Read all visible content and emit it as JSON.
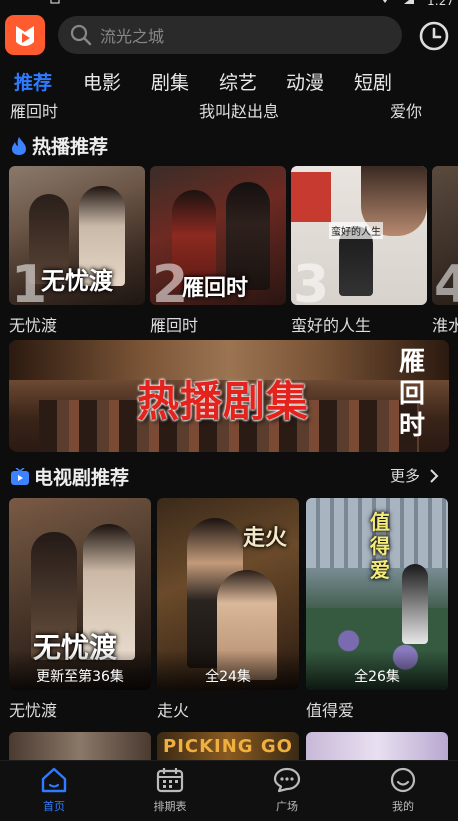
{
  "status_bar": {
    "time": "1:27"
  },
  "header": {
    "logo_icon": "app-logo-icon",
    "search_placeholder": "流光之城",
    "history_icon": "clock-icon"
  },
  "tabs": [
    {
      "label": "推荐",
      "active": true
    },
    {
      "label": "电影"
    },
    {
      "label": "剧集"
    },
    {
      "label": "综艺"
    },
    {
      "label": "动漫"
    },
    {
      "label": "短剧"
    }
  ],
  "marquee": [
    "雁回时",
    "我叫赵出息",
    "爱你"
  ],
  "hot": {
    "title": "热播推荐",
    "items": [
      {
        "rank": "1",
        "title": "无忧渡",
        "poster_text": "无忧渡"
      },
      {
        "rank": "2",
        "title": "雁回时",
        "poster_text": "雁回时"
      },
      {
        "rank": "3",
        "title": "蛮好的人生",
        "poster_text": "蛮好的人生"
      },
      {
        "rank": "4",
        "title": "淮水"
      }
    ]
  },
  "banner": {
    "text": "热播剧集",
    "vertical_text": "雁回时"
  },
  "tv": {
    "title": "电视剧推荐",
    "more_label": "更多",
    "items": [
      {
        "title": "无忧渡",
        "episodes": "更新至第36集",
        "poster_text": "无忧渡"
      },
      {
        "title": "走火",
        "episodes": "全24集",
        "poster_text": "走火"
      },
      {
        "title": "值得爱",
        "episodes": "全26集",
        "poster_text": "值得爱"
      }
    ],
    "next_row_text": "PICKING GO"
  },
  "nav": [
    {
      "label": "首页",
      "icon": "home-icon",
      "active": true
    },
    {
      "label": "排期表",
      "icon": "calendar-icon"
    },
    {
      "label": "广场",
      "icon": "chat-bubble-icon"
    },
    {
      "label": "我的",
      "icon": "smiley-user-icon"
    }
  ],
  "colors": {
    "accent": "#2f7bff",
    "logo": "#ff5b2e",
    "banner_text": "#e3231c",
    "background": "#0d0d0d"
  }
}
